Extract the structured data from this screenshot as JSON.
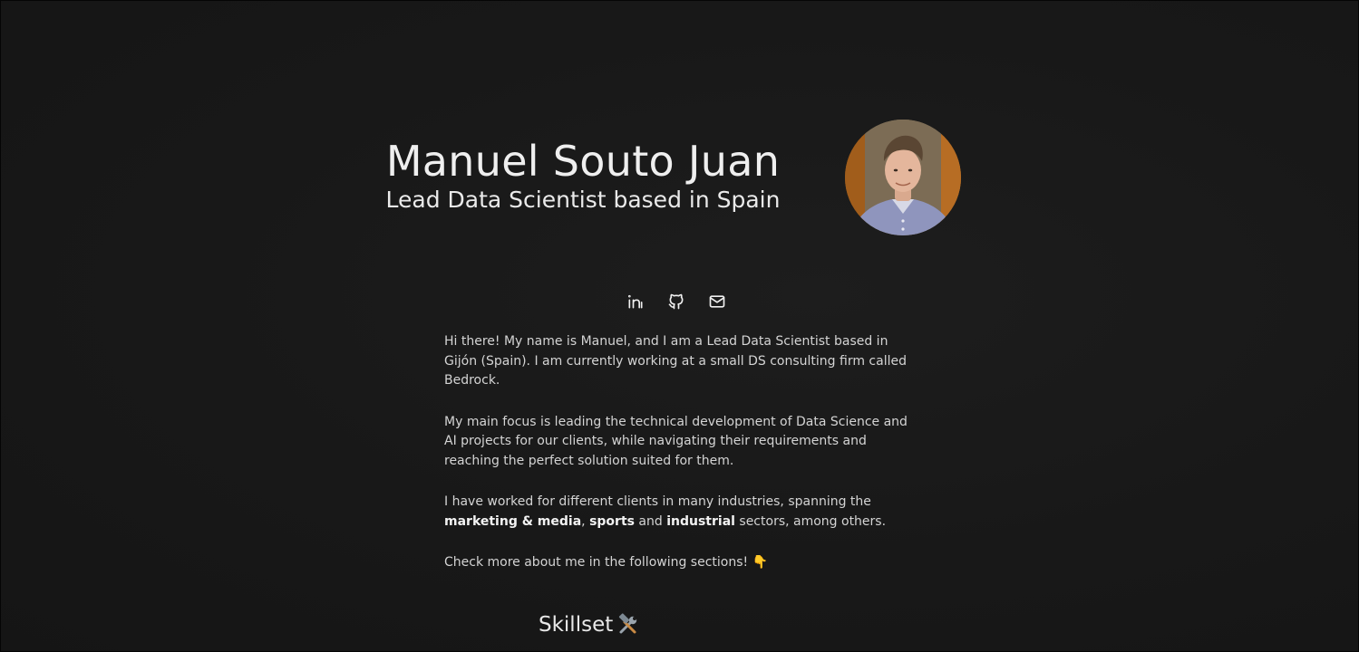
{
  "header": {
    "name": "Manuel Souto Juan",
    "subtitle": "Lead Data Scientist based in Spain"
  },
  "avatar": {
    "alt": "Manuel Souto Juan"
  },
  "socials": [
    {
      "icon": "linkedin-icon",
      "label": "LinkedIn"
    },
    {
      "icon": "github-icon",
      "label": "GitHub"
    },
    {
      "icon": "mail-icon",
      "label": "Email"
    }
  ],
  "bio": {
    "p1": "Hi there! My name is Manuel, and I am a Lead Data Scientist based in Gijón (Spain). I am currently working at a small DS consulting firm called Bedrock.",
    "p2": "My main focus is leading the technical development of Data Science and AI projects for our clients, while navigating their requirements and reaching the perfect solution suited for them.",
    "p3": {
      "before": "I have worked for different clients in many industries, spanning the ",
      "marketing": "marketing & media",
      "sep1": ", ",
      "sports": "sports",
      "sep2": " and ",
      "industrial": "industrial",
      "after": " sectors, among others."
    },
    "p4": "Check more about me in the following sections! 👇"
  },
  "sections": {
    "skillset_title": "Skillset",
    "skillset_emoji_icon": "hammer-and-wrench-icon"
  },
  "colors": {
    "background": "#191919",
    "text": "#e6e6e6",
    "muted_text": "#d4d4d4"
  }
}
